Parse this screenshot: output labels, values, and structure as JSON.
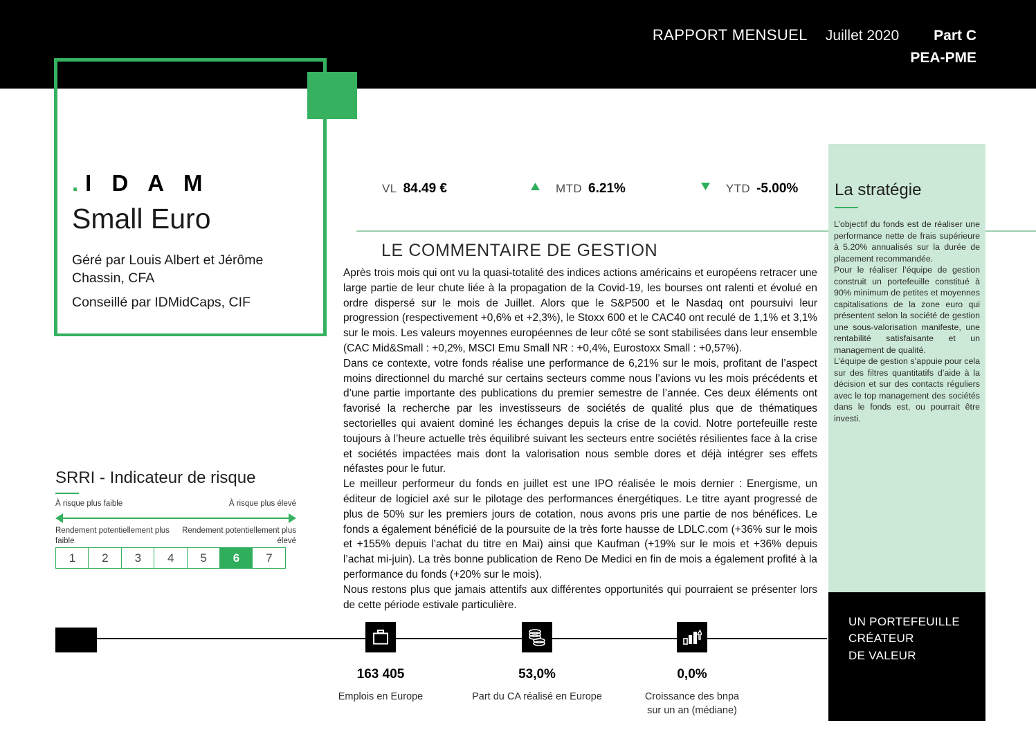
{
  "header": {
    "report_label": "RAPPORT MENSUEL",
    "month": "Juillet 2020",
    "part": "Part C",
    "share_class": "PEA-PME"
  },
  "logo": {
    "dot": ".",
    "brand": "I D A M",
    "fund_name": "Small Euro",
    "managers": "Géré par Louis Albert et Jérôme Chassin, CFA",
    "advisor": "Conseillé par IDMidCaps, CIF"
  },
  "metrics": {
    "vl_label": "VL",
    "vl_value": "84.49 €",
    "mtd_arrow": "up-arrow-icon",
    "mtd_label": "MTD",
    "mtd_value": "6.21%",
    "ytd_arrow": "down-arrow-icon",
    "ytd_label": "YTD",
    "ytd_value": "-5.00%",
    "arrow_up_glyph": "▲",
    "arrow_down_glyph": "▼",
    "accent_green": "#2fae5c"
  },
  "commentary": {
    "title": "LE COMMENTAIRE DE GESTION",
    "paragraphs": [
      "Après trois mois qui ont vu la quasi-totalité des indices actions américains et européens retracer une large partie de leur chute liée à la propagation de la Covid-19, les bourses ont ralenti et évolué en ordre dispersé sur le mois de Juillet. Alors que le S&P500 et le Nasdaq ont poursuivi leur progression (respectivement +0,6% et +2,3%), le Stoxx 600 et le CAC40 ont reculé de 1,1% et 3,1% sur le mois. Les valeurs moyennes européennes de leur côté se sont stabilisées dans leur ensemble (CAC Mid&Small : +0,2%, MSCI Emu Small NR : +0,4%, Eurostoxx Small : +0,57%).",
      "Dans ce contexte, votre fonds réalise une performance de 6,21% sur le mois, profitant de l’aspect moins directionnel du marché sur certains secteurs comme nous l’avions vu les mois précédents et d’une partie importante des publications du premier semestre de l’année. Ces deux éléments ont favorisé la recherche par les investisseurs de sociétés de qualité plus que de thématiques sectorielles qui avaient dominé les échanges depuis la crise de la covid. Notre portefeuille reste toujours à l’heure actuelle très équilibré suivant les secteurs entre sociétés résilientes face à la crise et sociétés impactées mais dont la valorisation nous semble dores et déjà intégrer ses effets néfastes pour le futur.",
      "Le meilleur performeur du fonds en juillet est une IPO réalisée le mois dernier : Energisme, un éditeur de logiciel axé sur le pilotage des performances énergétiques. Le titre ayant progressé de plus de 50% sur les premiers jours de cotation, nous avons pris une partie de nos bénéfices. Le fonds a également bénéficié de la poursuite de la très forte hausse de LDLC.com (+36% sur le mois et +155% depuis l’achat du titre en Mai) ainsi que Kaufman (+19% sur le mois et +36% depuis l’achat mi-juin). La très bonne publication de Reno De Medici en fin de mois a également profité à la performance du fonds (+20% sur le mois).",
      "Nous restons plus que jamais attentifs aux différentes opportunités qui pourraient se présenter lors de cette période estivale particulière."
    ]
  },
  "strategy": {
    "title": "La stratégie",
    "paragraphs": [
      "L’objectif du fonds est de réaliser une performance nette de frais supérieure à 5.20% annualisés sur la durée de placement recommandée.",
      "Pour le réaliser l’équipe de gestion construit un portefeuille constitué à 90% minimum de petites et moyennes capitalisations de la zone euro qui présentent selon la société de gestion une sous-valorisation manifeste, une rentabilité satisfaisante et un management de qualité.",
      "L’équipe de gestion s’appuie pour cela sur des filtres quantitatifs d’aide à la décision et sur des contacts réguliers avec le top management des sociétés dans le fonds est, ou pourrait être investi."
    ],
    "background": "#cce8d6"
  },
  "promo": {
    "line1": "UN PORTEFEUILLE",
    "line2": "CRÉATEUR",
    "line3": "DE VALEUR"
  },
  "srri": {
    "title": "SRRI - Indicateur de risque",
    "caption_left": "À risque plus faible",
    "caption_right": "À risque plus élevé",
    "return_left": "Rendement potentiellement plus faible",
    "return_right": "Rendement potentiellement plus élevé",
    "levels": [
      "1",
      "2",
      "3",
      "4",
      "5",
      "6",
      "7"
    ],
    "active_level": 6,
    "accent": "#2fae5c"
  },
  "stats": [
    {
      "icon": "briefcase-icon",
      "value": "163 405",
      "label_line1": "Emplois en Europe",
      "label_line2": ""
    },
    {
      "icon": "coins-icon",
      "value": "53,0%",
      "label_line1": "Part du CA réalisé en Europe",
      "label_line2": ""
    },
    {
      "icon": "bar-chart-growth-icon",
      "value": "0,0%",
      "label_line1": "Croissance des bnpa",
      "label_line2": "sur un an (médiane)"
    }
  ]
}
